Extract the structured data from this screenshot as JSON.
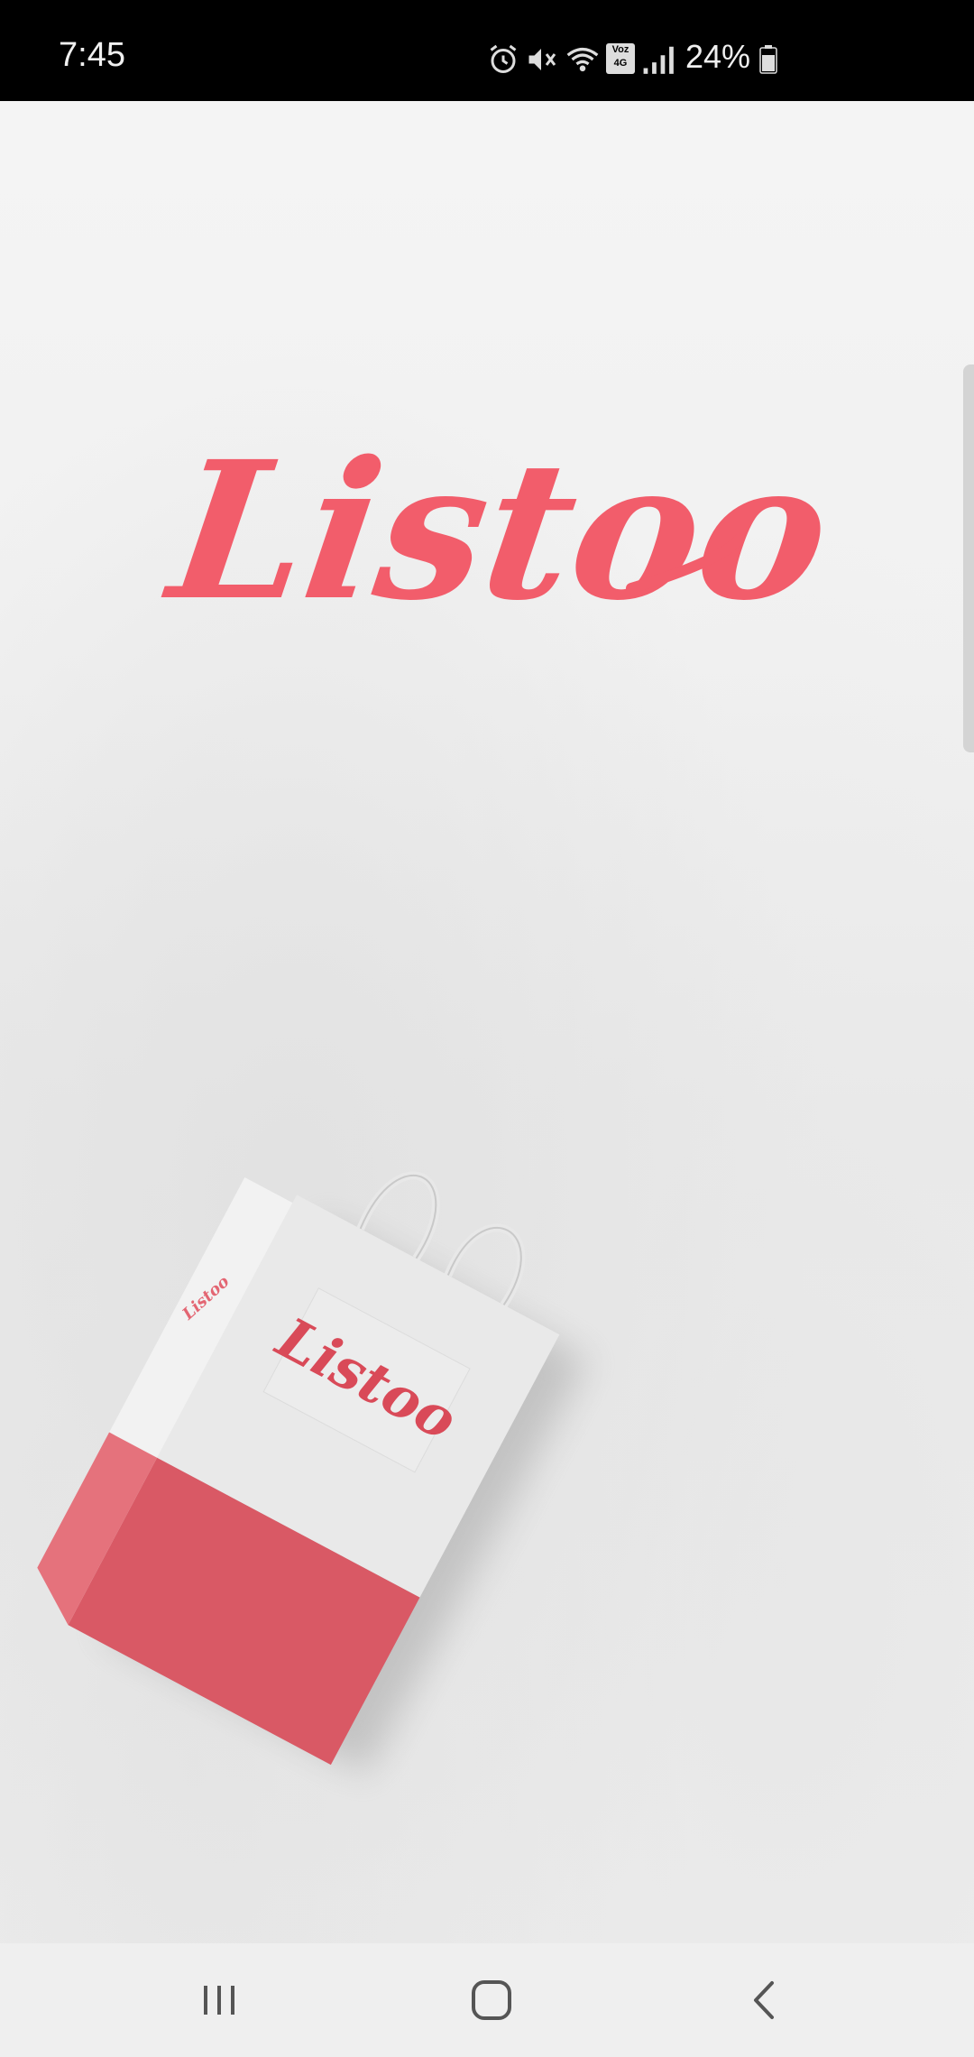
{
  "status_bar": {
    "time": "7:45",
    "battery_percent": "24%",
    "icons": [
      "alarm-icon",
      "mute-icon",
      "wifi-icon",
      "volte-4g-icon",
      "signal-icon",
      "battery-icon"
    ],
    "volte_label": "Voz",
    "network_label": "4G"
  },
  "splash": {
    "logo_text": "Listoo",
    "brand_color": "#f25d6b",
    "bag_logo_text": "Listoo",
    "bag_side_logo_text": "Listoo",
    "loading": true
  },
  "nav_bar": {
    "buttons": [
      "recent-apps",
      "home",
      "back"
    ]
  }
}
